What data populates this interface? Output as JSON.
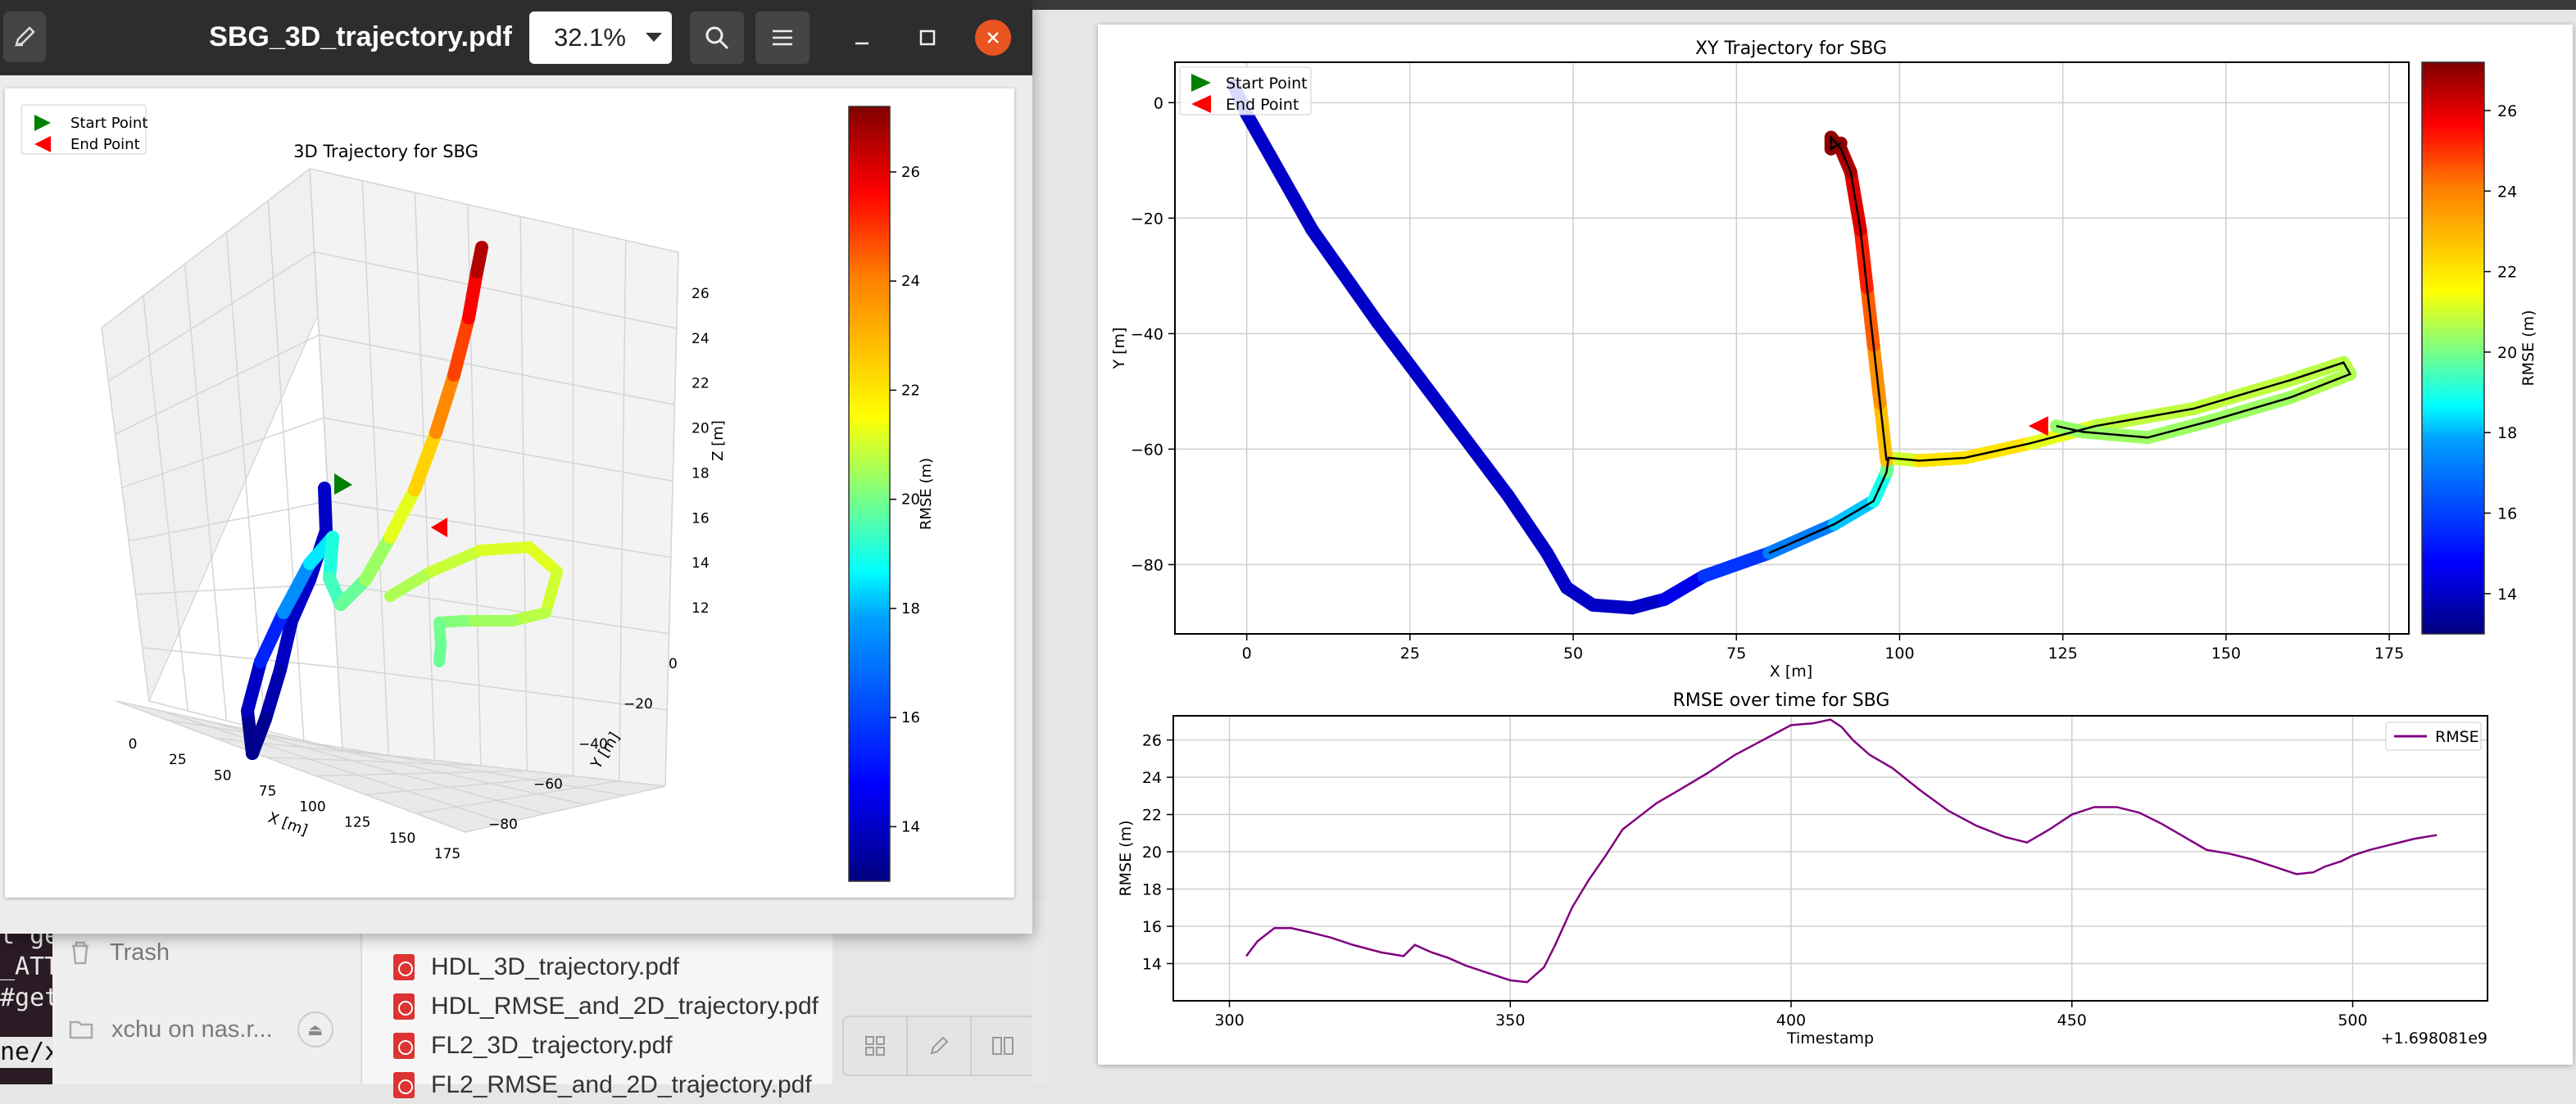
{
  "left_window": {
    "title": "SBG_3D_trajectory.pdf",
    "zoom": "32.1%",
    "icons": {
      "edit": "pen-icon",
      "search": "search-icon",
      "menu": "hamburger-menu-icon",
      "minimize": "minimize-icon",
      "maximize": "maximize-icon",
      "close": "close-icon"
    }
  },
  "file_manager": {
    "sidebar": [
      {
        "label": "Trash",
        "icon": "trash-icon"
      },
      {
        "label": "xchu on nas.r...",
        "icon": "network-folder-icon"
      }
    ],
    "files": [
      {
        "name": "HDL_3D_trajectory.pdf"
      },
      {
        "name": "HDL_RMSE_and_2D_trajectory.pdf"
      },
      {
        "name": "FL2_3D_trajectory.pdf"
      },
      {
        "name": "FL2_RMSE_and_2D_trajectory.pdf"
      }
    ],
    "toolbar_icons": [
      "grid-view-icon",
      "edit-icon",
      "book-icon"
    ]
  },
  "terminal": {
    "lines": [
      "t ge",
      "_ATT",
      "#get"
    ],
    "prompt": "ne/xc"
  },
  "legend": {
    "start": "Start Point",
    "end": "End Point"
  },
  "colors": {
    "start_marker": "#008000",
    "end_marker": "#ff0000",
    "rmse_line": "#800080",
    "accent": "#e95420"
  },
  "chart_data": [
    {
      "type": "line",
      "title": "3D Trajectory for SBG",
      "xlabel": "X [m]",
      "ylabel": "Y [m]",
      "zlabel": "Z [m]",
      "x_ticks": [
        "0",
        "25",
        "50",
        "75",
        "100",
        "125",
        "150",
        "175"
      ],
      "y_ticks": [
        "0",
        "−20",
        "−40",
        "−60",
        "−80"
      ],
      "z_ticks": [
        "12",
        "14",
        "16",
        "18",
        "20",
        "22",
        "24",
        "26"
      ],
      "colorbar": {
        "label": "RMSE (m)",
        "ticks": [
          "14",
          "16",
          "18",
          "20",
          "22",
          "24",
          "26"
        ],
        "range": [
          13,
          27.2
        ],
        "colormap": "jet"
      }
    },
    {
      "type": "line",
      "title": "XY Trajectory for SBG",
      "xlabel": "X [m]",
      "ylabel": "Y [m]",
      "xlim": [
        -11,
        178
      ],
      "ylim": [
        -92,
        7
      ],
      "x_ticks": [
        "0",
        "25",
        "50",
        "75",
        "100",
        "125",
        "150",
        "175"
      ],
      "y_ticks": [
        "0",
        "−20",
        "−40",
        "−60",
        "−80"
      ],
      "grid": true,
      "legend": "top-left",
      "path": [
        [
          -2,
          3
        ],
        [
          0,
          -2
        ],
        [
          10,
          -22
        ],
        [
          20,
          -38
        ],
        [
          30,
          -53
        ],
        [
          40,
          -68
        ],
        [
          46,
          -78
        ],
        [
          49,
          -84
        ],
        [
          53,
          -87
        ],
        [
          59,
          -87.5
        ],
        [
          64,
          -86
        ],
        [
          70,
          -82
        ],
        [
          80,
          -78
        ],
        [
          90,
          -73
        ],
        [
          96,
          -69
        ],
        [
          98,
          -64
        ],
        [
          98.3,
          -61.5
        ],
        [
          103,
          -62
        ],
        [
          110,
          -61.5
        ],
        [
          120,
          -59
        ],
        [
          130,
          -56
        ],
        [
          145,
          -53
        ],
        [
          160,
          -48
        ],
        [
          168,
          -45
        ],
        [
          169,
          -47
        ],
        [
          160,
          -51
        ],
        [
          148,
          -55
        ],
        [
          138,
          -58
        ],
        [
          128,
          -57
        ],
        [
          124,
          -56
        ]
      ],
      "rmse": [
        14.8,
        14,
        14,
        14,
        14,
        14,
        14,
        14,
        14,
        14,
        14,
        15,
        16,
        17,
        18,
        19.2,
        20.5,
        22,
        22.5,
        22,
        21,
        21,
        21,
        20.8,
        21,
        20.5,
        20.5,
        20.5,
        20.5,
        20.3
      ],
      "spur": [
        [
          98,
          -62
        ],
        [
          97,
          -52
        ],
        [
          96,
          -42
        ],
        [
          95,
          -32
        ],
        [
          94,
          -22
        ],
        [
          92.5,
          -12
        ],
        [
          91,
          -8
        ],
        [
          89.5,
          -6
        ],
        [
          89.5,
          -8
        ],
        [
          91,
          -7
        ]
      ],
      "spur_rmse": [
        22.5,
        23,
        23.8,
        24.5,
        25.5,
        26.3,
        26.8,
        27,
        27,
        27
      ],
      "start": [
        -2,
        3
      ],
      "end": [
        121,
        -56
      ],
      "colorbar": {
        "label": "RMSE (m)",
        "ticks": [
          "14",
          "16",
          "18",
          "20",
          "22",
          "24",
          "26"
        ],
        "range": [
          13,
          27.2
        ],
        "colormap": "jet"
      }
    },
    {
      "type": "line",
      "title": "RMSE over time for SBG",
      "xlabel": "Timestamp",
      "ylabel": "RMSE (m)",
      "offset_label": "+1.698081e9",
      "xlim": [
        290,
        524
      ],
      "ylim": [
        12,
        27.3
      ],
      "x_ticks": [
        "300",
        "350",
        "400",
        "450",
        "500"
      ],
      "y_ticks": [
        "14",
        "16",
        "18",
        "20",
        "22",
        "24",
        "26"
      ],
      "grid": true,
      "legend": "top-right",
      "series": [
        {
          "name": "RMSE",
          "x": [
            303,
            305,
            308,
            311,
            314,
            318,
            322,
            327,
            331,
            333,
            336,
            339,
            342,
            346,
            350,
            353,
            356,
            358,
            361,
            364,
            367,
            370,
            373,
            376,
            380,
            385,
            390,
            395,
            400,
            404,
            407,
            409,
            411,
            414,
            418,
            423,
            428,
            433,
            438,
            442,
            446,
            450,
            454,
            458,
            462,
            466,
            470,
            474,
            478,
            482,
            486,
            490,
            493,
            495,
            498,
            500,
            503,
            507,
            511,
            515
          ],
          "y": [
            14.4,
            15.2,
            15.9,
            15.9,
            15.7,
            15.4,
            15,
            14.6,
            14.4,
            15,
            14.6,
            14.3,
            13.9,
            13.5,
            13.1,
            13,
            13.8,
            15,
            17,
            18.5,
            19.8,
            21.2,
            21.9,
            22.6,
            23.3,
            24.2,
            25.2,
            26,
            26.8,
            26.9,
            27.1,
            26.7,
            26,
            25.2,
            24.5,
            23.3,
            22.2,
            21.4,
            20.8,
            20.5,
            21.2,
            22,
            22.4,
            22.4,
            22.1,
            21.5,
            20.8,
            20.1,
            19.9,
            19.6,
            19.2,
            18.8,
            18.9,
            19.2,
            19.5,
            19.8,
            20.1,
            20.4,
            20.7,
            20.9
          ]
        }
      ]
    }
  ]
}
